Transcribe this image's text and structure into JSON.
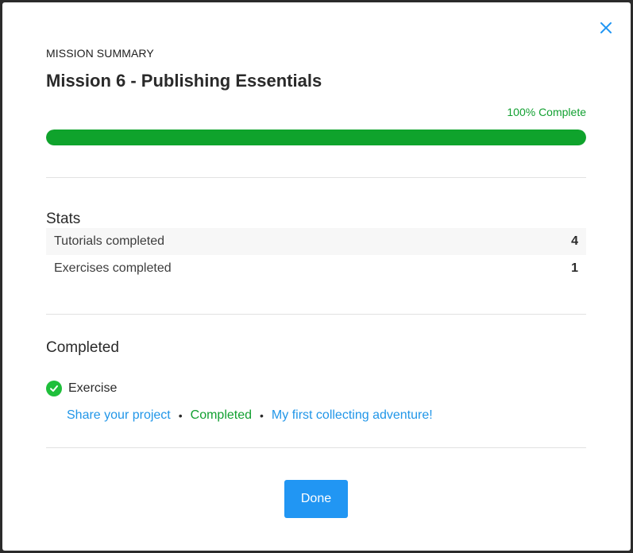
{
  "modal": {
    "eyebrow": "MISSION SUMMARY",
    "title": "Mission 6 - Publishing Essentials",
    "progress": {
      "label": "100% Complete",
      "percent": 100,
      "color": "#0fa32c"
    },
    "close_icon": "close-icon"
  },
  "stats": {
    "heading": "Stats",
    "rows": [
      {
        "label": "Tutorials completed",
        "value": "4"
      },
      {
        "label": "Exercises completed",
        "value": "1"
      }
    ]
  },
  "completed": {
    "heading": "Completed",
    "items": [
      {
        "type": "Exercise",
        "icon": "check-circle-icon",
        "title": "Share your project",
        "status": "Completed",
        "project": "My first collecting adventure!"
      }
    ]
  },
  "footer": {
    "done_label": "Done"
  },
  "colors": {
    "accent": "#2196f3",
    "success": "#12a031",
    "link": "#2196e8"
  }
}
